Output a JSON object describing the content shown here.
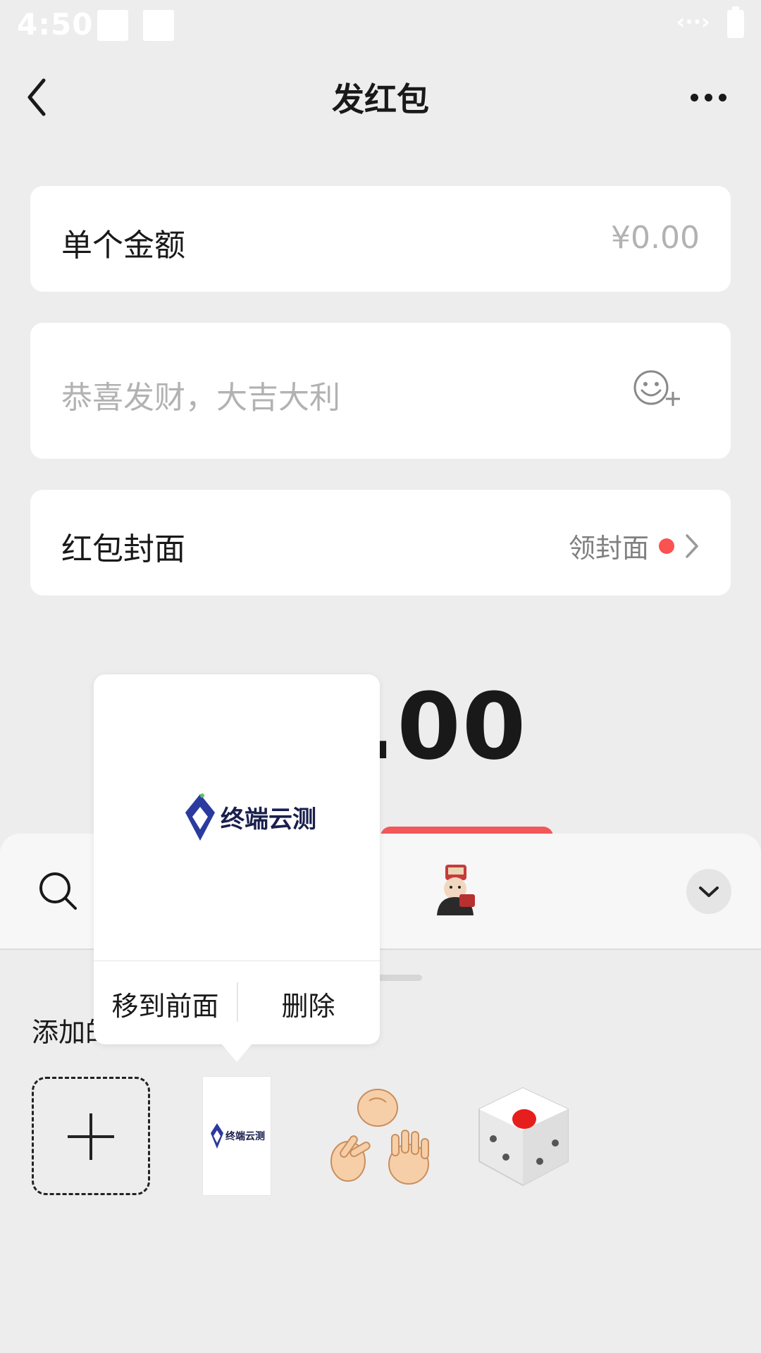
{
  "status_bar": {
    "time": "4:50"
  },
  "nav": {
    "title": "发红包"
  },
  "amount_card": {
    "label": "单个金额",
    "value": "¥0.00"
  },
  "greeting_card": {
    "placeholder": "恭喜发财，大吉大利"
  },
  "cover_card": {
    "label": "红包封面",
    "link": "领封面"
  },
  "total": {
    "amount_visible": ".00"
  },
  "panel": {
    "section_label": "添加的"
  },
  "popup": {
    "logo_text": "终端云测",
    "move_front": "移到前面",
    "delete": "删除"
  },
  "colors": {
    "accent_red": "#fa5151",
    "send_button": "#f25858",
    "logo_blue": "#2b3a9e"
  }
}
